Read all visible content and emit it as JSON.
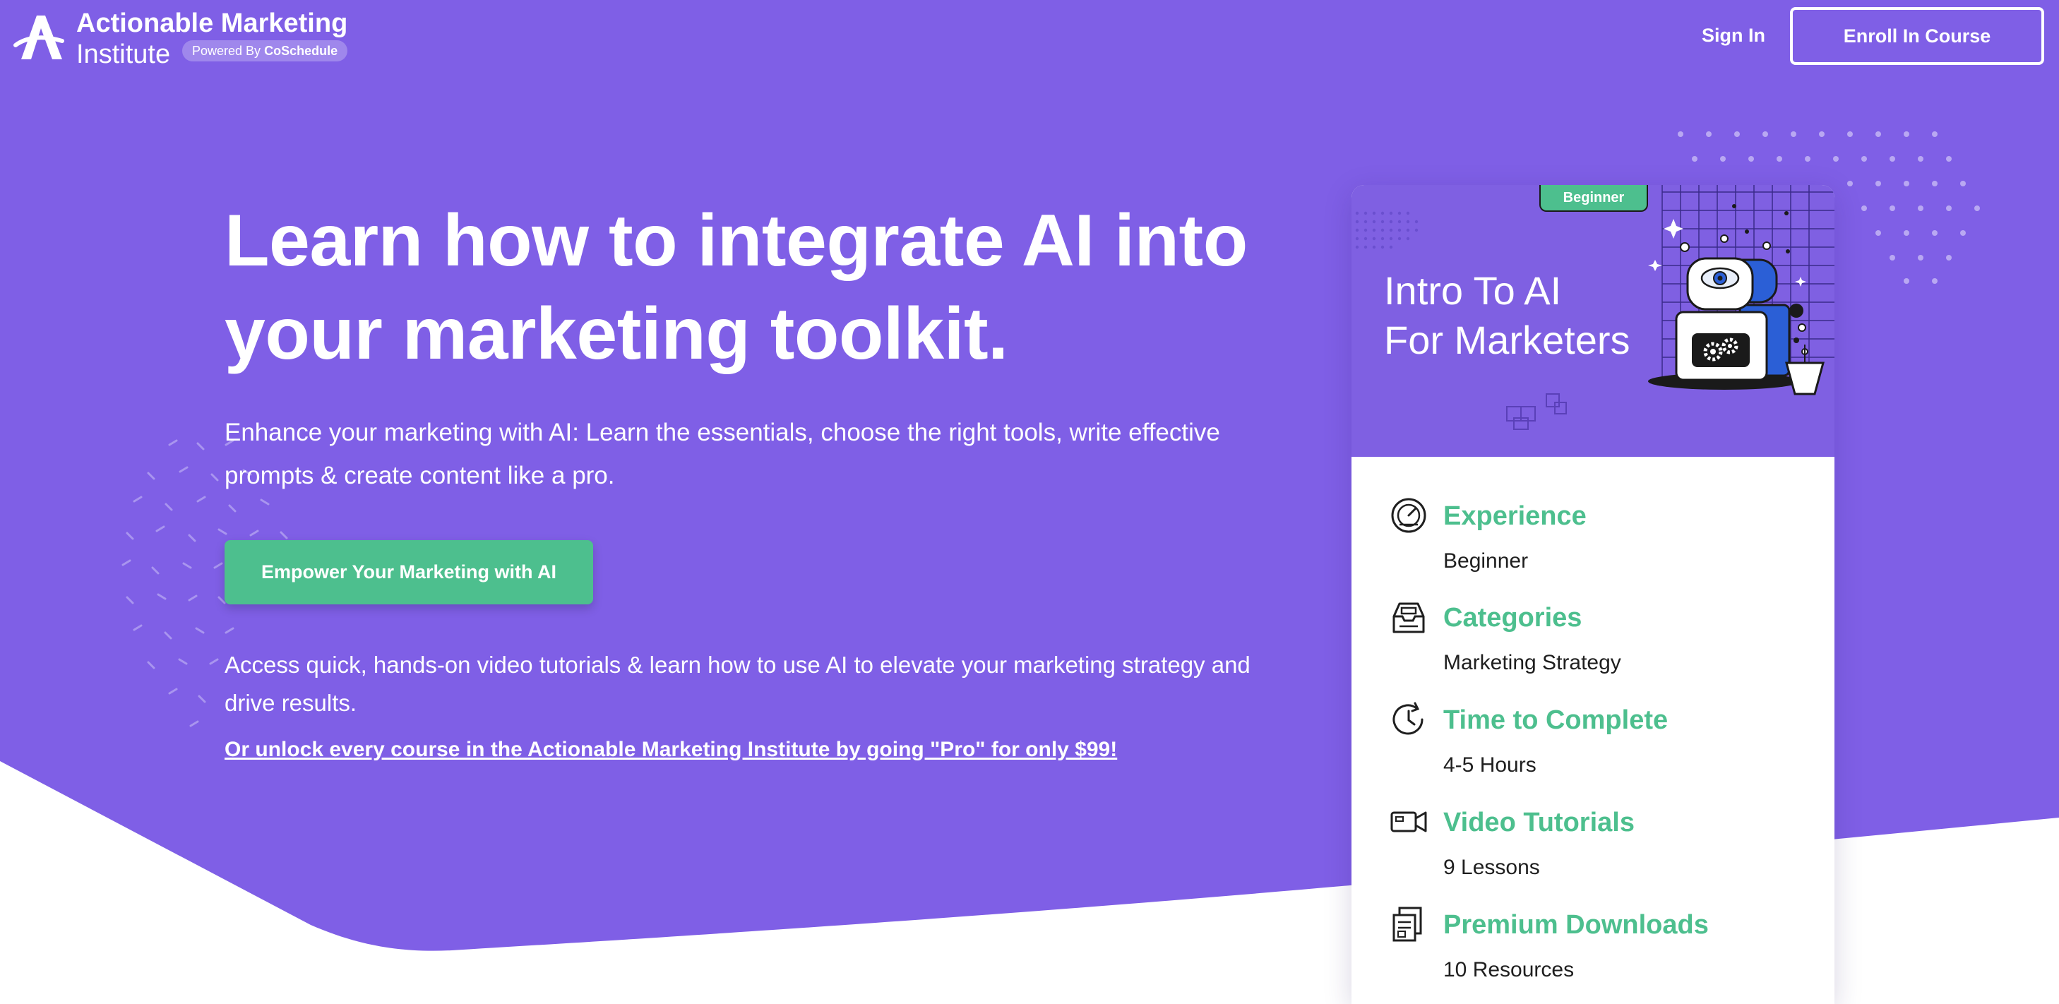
{
  "colors": {
    "hero_purple": "#7f5fe6",
    "accent_green": "#4dbf8e",
    "text_white": "#ffffff",
    "text_dark": "#1f1f1f"
  },
  "header": {
    "logo_line1": "Actionable Marketing",
    "logo_line2": "Institute",
    "powered_prefix": "Powered By",
    "powered_brand": "CoSchedule",
    "sign_in_label": "Sign In",
    "enroll_label": "Enroll In Course"
  },
  "hero": {
    "title_line1": "Learn how to integrate AI into",
    "title_line2": "your marketing toolkit.",
    "subtitle_line1": "Enhance your marketing with AI: Learn the essentials, choose the right tools, write effective",
    "subtitle_line2": "prompts & create content like a pro.",
    "cta_label": "Empower Your Marketing with AI",
    "access_line1": "Access quick, hands-on video tutorials & learn how to use AI to elevate your marketing strategy and",
    "access_line2": "drive results.",
    "pro_link": "Or unlock every course in the Actionable Marketing Institute by going \"Pro\" for only $99!"
  },
  "card": {
    "badge": "Beginner",
    "title_line1": "Intro To AI",
    "title_line2": "For Marketers",
    "details": [
      {
        "icon": "speedometer-icon",
        "label": "Experience",
        "value": "Beginner"
      },
      {
        "icon": "inbox-tray-icon",
        "label": "Categories",
        "value": "Marketing Strategy"
      },
      {
        "icon": "clock-refresh-icon",
        "label": "Time to Complete",
        "value": "4-5 Hours"
      },
      {
        "icon": "video-camera-icon",
        "label": "Video Tutorials",
        "value": "9 Lessons"
      },
      {
        "icon": "documents-icon",
        "label": "Premium Downloads",
        "value": "10 Resources"
      }
    ]
  }
}
